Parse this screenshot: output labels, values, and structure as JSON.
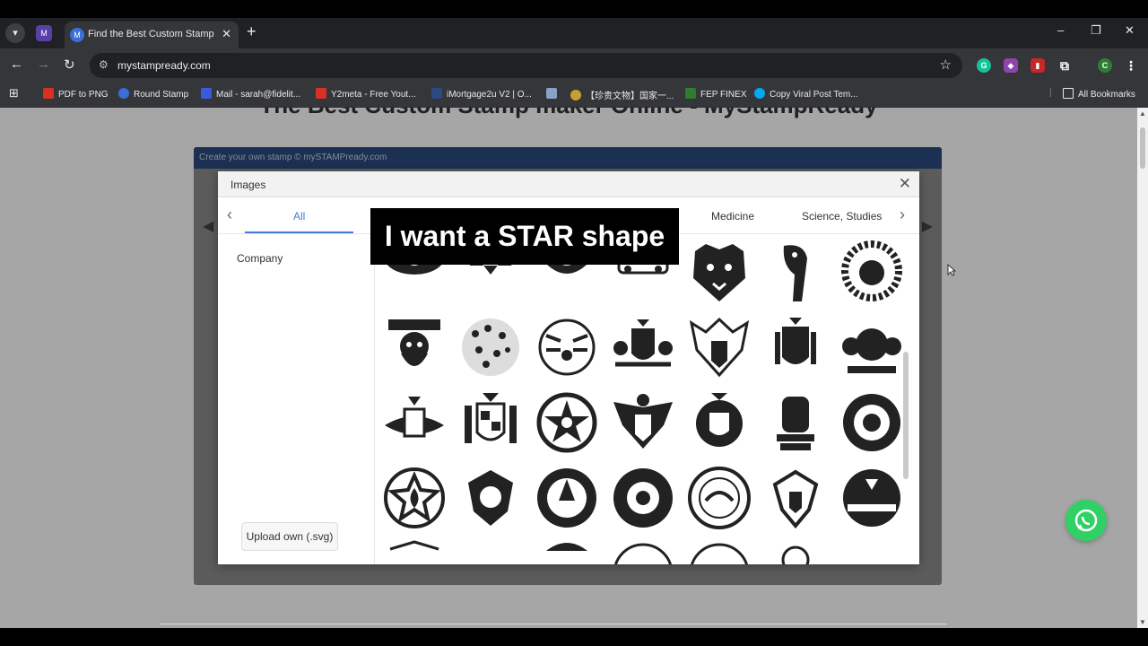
{
  "browser": {
    "tab_title": "Find the Best Custom Stamp M",
    "url": "mystampready.com",
    "window_controls": [
      "–",
      "❐",
      "✕"
    ],
    "bookmarks": [
      {
        "label": "PDF to PNG",
        "color": "#d93025"
      },
      {
        "label": "Round Stamp",
        "color": "#3b6fd8"
      },
      {
        "label": "Mail - sarah@fidelit...",
        "color": "#3b5bd8"
      },
      {
        "label": "Y2meta - Free Yout...",
        "color": "#d93025"
      },
      {
        "label": "iMortgage2u V2 | O...",
        "color": "#2a4a80"
      },
      {
        "label": "",
        "color": "#8aa0c8"
      },
      {
        "label": "【珍贵文物】国家一...",
        "color": "#c8a030"
      },
      {
        "label": "FEP FINEX",
        "color": "#2e7d32"
      },
      {
        "label": "Copy Viral Post Tem...",
        "color": "#03a9f4"
      }
    ],
    "all_bookmarks": "All Bookmarks"
  },
  "page": {
    "heading": "The Best Custom Stamp maker Online - MyStampReady",
    "editor_header": "Create your own stamp © mySTAMPready.com"
  },
  "modal": {
    "title": "Images",
    "categories": [
      "All",
      "Medicine",
      "Science, Studies"
    ],
    "sidebar_items": [
      "Company"
    ],
    "upload_button": "Upload own (.svg)"
  },
  "caption": "I want a STAR shape",
  "colors": {
    "accent": "#4a7ad8",
    "editor_header": "#2a4a80",
    "whatsapp": "#2fd165"
  }
}
